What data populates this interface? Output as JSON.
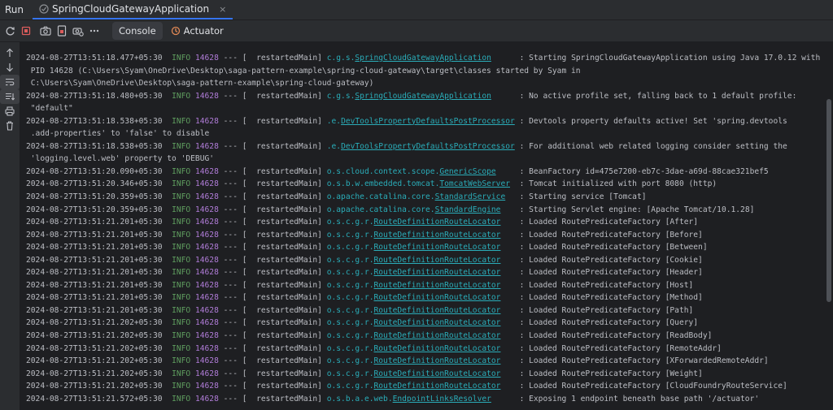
{
  "header": {
    "run_label": "Run",
    "tab_label": "SpringCloudGatewayApplication",
    "close_glyph": "×"
  },
  "toolbar": {
    "console_label": "Console",
    "actuator_label": "Actuator"
  },
  "colors": {
    "accent": "#3574f0",
    "info": "#5f9e5f",
    "pid": "#b07cd8",
    "logger": "#2aacb8",
    "stop_red": "#db5c5c"
  },
  "log_lines": [
    {
      "ts": "2024-08-27T13:51:18.477+05:30",
      "level": "INFO",
      "pid": "14628",
      "sep": "---",
      "thread": "[  restartedMain]",
      "logger_prefix": "c.g.s.",
      "logger_link": "SpringCloudGatewayApplication",
      "pad": "      ",
      "message": ": Starting SpringCloudGatewayApplication using Java 17.0.12 with"
    },
    {
      "cont": " PID 14628 (C:\\Users\\Syam\\OneDrive\\Desktop\\saga-pattern-example\\spring-cloud-gateway\\target\\classes started by Syam in"
    },
    {
      "cont": " C:\\Users\\Syam\\OneDrive\\Desktop\\saga-pattern-example\\spring-cloud-gateway)"
    },
    {
      "ts": "2024-08-27T13:51:18.480+05:30",
      "level": "INFO",
      "pid": "14628",
      "sep": "---",
      "thread": "[  restartedMain]",
      "logger_prefix": "c.g.s.",
      "logger_link": "SpringCloudGatewayApplication",
      "pad": "      ",
      "message": ": No active profile set, falling back to 1 default profile:"
    },
    {
      "cont": " \"default\""
    },
    {
      "ts": "2024-08-27T13:51:18.538+05:30",
      "level": "INFO",
      "pid": "14628",
      "sep": "---",
      "thread": "[  restartedMain]",
      "logger_prefix": ".e.",
      "logger_link": "DevToolsPropertyDefaultsPostProcessor",
      "pad": " ",
      "message": ": Devtools property defaults active! Set 'spring.devtools"
    },
    {
      "cont": " .add-properties' to 'false' to disable"
    },
    {
      "ts": "2024-08-27T13:51:18.538+05:30",
      "level": "INFO",
      "pid": "14628",
      "sep": "---",
      "thread": "[  restartedMain]",
      "logger_prefix": ".e.",
      "logger_link": "DevToolsPropertyDefaultsPostProcessor",
      "pad": " ",
      "message": ": For additional web related logging consider setting the"
    },
    {
      "cont": " 'logging.level.web' property to 'DEBUG'"
    },
    {
      "ts": "2024-08-27T13:51:20.090+05:30",
      "level": "INFO",
      "pid": "14628",
      "sep": "---",
      "thread": "[  restartedMain]",
      "logger_prefix": "o.s.cloud.context.scope.",
      "logger_link": "GenericScope",
      "pad": "     ",
      "message": ": BeanFactory id=475e7200-eb7c-3dae-a69d-88cae321bef5"
    },
    {
      "ts": "2024-08-27T13:51:20.346+05:30",
      "level": "INFO",
      "pid": "14628",
      "sep": "---",
      "thread": "[  restartedMain]",
      "logger_prefix": "o.s.b.w.embedded.tomcat.",
      "logger_link": "TomcatWebServer",
      "pad": "  ",
      "message": ": Tomcat initialized with port 8080 (http)"
    },
    {
      "ts": "2024-08-27T13:51:20.359+05:30",
      "level": "INFO",
      "pid": "14628",
      "sep": "---",
      "thread": "[  restartedMain]",
      "logger_prefix": "o.apache.catalina.core.",
      "logger_link": "StandardService",
      "pad": "   ",
      "message": ": Starting service [Tomcat]"
    },
    {
      "ts": "2024-08-27T13:51:20.359+05:30",
      "level": "INFO",
      "pid": "14628",
      "sep": "---",
      "thread": "[  restartedMain]",
      "logger_prefix": "o.apache.catalina.core.",
      "logger_link": "StandardEngine",
      "pad": "    ",
      "message": ": Starting Servlet engine: [Apache Tomcat/10.1.28]"
    },
    {
      "ts": "2024-08-27T13:51:21.201+05:30",
      "level": "INFO",
      "pid": "14628",
      "sep": "---",
      "thread": "[  restartedMain]",
      "logger_prefix": "o.s.c.g.r.",
      "logger_link": "RouteDefinitionRouteLocator",
      "pad": "    ",
      "message": ": Loaded RoutePredicateFactory [After]"
    },
    {
      "ts": "2024-08-27T13:51:21.201+05:30",
      "level": "INFO",
      "pid": "14628",
      "sep": "---",
      "thread": "[  restartedMain]",
      "logger_prefix": "o.s.c.g.r.",
      "logger_link": "RouteDefinitionRouteLocator",
      "pad": "    ",
      "message": ": Loaded RoutePredicateFactory [Before]"
    },
    {
      "ts": "2024-08-27T13:51:21.201+05:30",
      "level": "INFO",
      "pid": "14628",
      "sep": "---",
      "thread": "[  restartedMain]",
      "logger_prefix": "o.s.c.g.r.",
      "logger_link": "RouteDefinitionRouteLocator",
      "pad": "    ",
      "message": ": Loaded RoutePredicateFactory [Between]"
    },
    {
      "ts": "2024-08-27T13:51:21.201+05:30",
      "level": "INFO",
      "pid": "14628",
      "sep": "---",
      "thread": "[  restartedMain]",
      "logger_prefix": "o.s.c.g.r.",
      "logger_link": "RouteDefinitionRouteLocator",
      "pad": "    ",
      "message": ": Loaded RoutePredicateFactory [Cookie]"
    },
    {
      "ts": "2024-08-27T13:51:21.201+05:30",
      "level": "INFO",
      "pid": "14628",
      "sep": "---",
      "thread": "[  restartedMain]",
      "logger_prefix": "o.s.c.g.r.",
      "logger_link": "RouteDefinitionRouteLocator",
      "pad": "    ",
      "message": ": Loaded RoutePredicateFactory [Header]"
    },
    {
      "ts": "2024-08-27T13:51:21.201+05:30",
      "level": "INFO",
      "pid": "14628",
      "sep": "---",
      "thread": "[  restartedMain]",
      "logger_prefix": "o.s.c.g.r.",
      "logger_link": "RouteDefinitionRouteLocator",
      "pad": "    ",
      "message": ": Loaded RoutePredicateFactory [Host]"
    },
    {
      "ts": "2024-08-27T13:51:21.201+05:30",
      "level": "INFO",
      "pid": "14628",
      "sep": "---",
      "thread": "[  restartedMain]",
      "logger_prefix": "o.s.c.g.r.",
      "logger_link": "RouteDefinitionRouteLocator",
      "pad": "    ",
      "message": ": Loaded RoutePredicateFactory [Method]"
    },
    {
      "ts": "2024-08-27T13:51:21.201+05:30",
      "level": "INFO",
      "pid": "14628",
      "sep": "---",
      "thread": "[  restartedMain]",
      "logger_prefix": "o.s.c.g.r.",
      "logger_link": "RouteDefinitionRouteLocator",
      "pad": "    ",
      "message": ": Loaded RoutePredicateFactory [Path]"
    },
    {
      "ts": "2024-08-27T13:51:21.202+05:30",
      "level": "INFO",
      "pid": "14628",
      "sep": "---",
      "thread": "[  restartedMain]",
      "logger_prefix": "o.s.c.g.r.",
      "logger_link": "RouteDefinitionRouteLocator",
      "pad": "    ",
      "message": ": Loaded RoutePredicateFactory [Query]"
    },
    {
      "ts": "2024-08-27T13:51:21.202+05:30",
      "level": "INFO",
      "pid": "14628",
      "sep": "---",
      "thread": "[  restartedMain]",
      "logger_prefix": "o.s.c.g.r.",
      "logger_link": "RouteDefinitionRouteLocator",
      "pad": "    ",
      "message": ": Loaded RoutePredicateFactory [ReadBody]"
    },
    {
      "ts": "2024-08-27T13:51:21.202+05:30",
      "level": "INFO",
      "pid": "14628",
      "sep": "---",
      "thread": "[  restartedMain]",
      "logger_prefix": "o.s.c.g.r.",
      "logger_link": "RouteDefinitionRouteLocator",
      "pad": "    ",
      "message": ": Loaded RoutePredicateFactory [RemoteAddr]"
    },
    {
      "ts": "2024-08-27T13:51:21.202+05:30",
      "level": "INFO",
      "pid": "14628",
      "sep": "---",
      "thread": "[  restartedMain]",
      "logger_prefix": "o.s.c.g.r.",
      "logger_link": "RouteDefinitionRouteLocator",
      "pad": "    ",
      "message": ": Loaded RoutePredicateFactory [XForwardedRemoteAddr]"
    },
    {
      "ts": "2024-08-27T13:51:21.202+05:30",
      "level": "INFO",
      "pid": "14628",
      "sep": "---",
      "thread": "[  restartedMain]",
      "logger_prefix": "o.s.c.g.r.",
      "logger_link": "RouteDefinitionRouteLocator",
      "pad": "    ",
      "message": ": Loaded RoutePredicateFactory [Weight]"
    },
    {
      "ts": "2024-08-27T13:51:21.202+05:30",
      "level": "INFO",
      "pid": "14628",
      "sep": "---",
      "thread": "[  restartedMain]",
      "logger_prefix": "o.s.c.g.r.",
      "logger_link": "RouteDefinitionRouteLocator",
      "pad": "    ",
      "message": ": Loaded RoutePredicateFactory [CloudFoundryRouteService]"
    },
    {
      "ts": "2024-08-27T13:51:21.572+05:30",
      "level": "INFO",
      "pid": "14628",
      "sep": "---",
      "thread": "[  restartedMain]",
      "logger_prefix": "o.s.b.a.e.web.",
      "logger_link": "EndpointLinksResolver",
      "pad": "      ",
      "message": ": Exposing 1 endpoint beneath base path '/actuator'"
    }
  ]
}
